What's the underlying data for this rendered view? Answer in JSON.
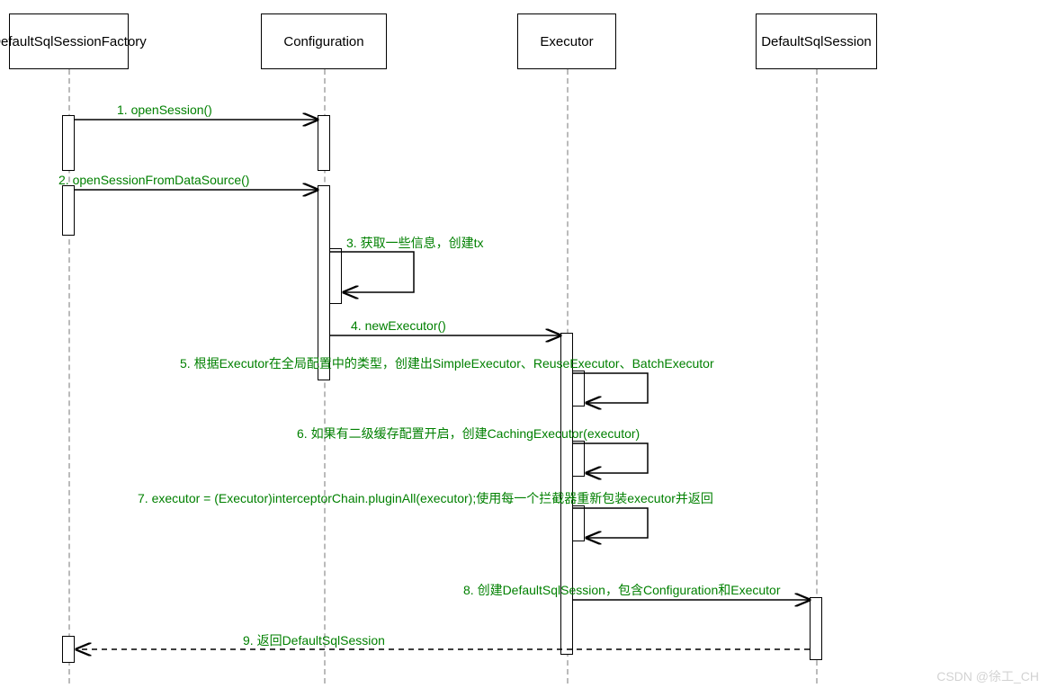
{
  "participants": {
    "p1": "DefaultSqlSessionFactory",
    "p2": "Configuration",
    "p3": "Executor",
    "p4": "DefaultSqlSession"
  },
  "messages": {
    "m1": "1. openSession()",
    "m2": "2. openSessionFromDataSource()",
    "m3": "3. 获取一些信息，创建tx",
    "m4": "4. newExecutor()",
    "m5": "5. 根据Executor在全局配置中的类型，创建出SimpleExecutor、ReuseExecutor、BatchExecutor",
    "m6": "6. 如果有二级缓存配置开启，创建CachingExecutor(executor)",
    "m7": "7. executor = (Executor)interceptorChain.pluginAll(executor);使用每一个拦截器重新包装executor并返回",
    "m8": "8. 创建DefaultSqlSession，包含Configuration和Executor",
    "m9": "9. 返回DefaultSqlSession"
  },
  "watermark": "CSDN @徐工_CH",
  "chart_data": {
    "type": "sequence-diagram",
    "participants": [
      "DefaultSqlSessionFactory",
      "Configuration",
      "Executor",
      "DefaultSqlSession"
    ],
    "interactions": [
      {
        "n": 1,
        "from": "DefaultSqlSessionFactory",
        "to": "Configuration",
        "kind": "call",
        "label": "openSession()"
      },
      {
        "n": 2,
        "from": "DefaultSqlSessionFactory",
        "to": "Configuration",
        "kind": "call",
        "label": "openSessionFromDataSource()"
      },
      {
        "n": 3,
        "from": "Configuration",
        "to": "Configuration",
        "kind": "self",
        "label": "获取一些信息，创建tx"
      },
      {
        "n": 4,
        "from": "Configuration",
        "to": "Executor",
        "kind": "call",
        "label": "newExecutor()"
      },
      {
        "n": 5,
        "from": "Executor",
        "to": "Executor",
        "kind": "self",
        "label": "根据Executor在全局配置中的类型，创建出SimpleExecutor、ReuseExecutor、BatchExecutor"
      },
      {
        "n": 6,
        "from": "Executor",
        "to": "Executor",
        "kind": "self",
        "label": "如果有二级缓存配置开启，创建CachingExecutor(executor)"
      },
      {
        "n": 7,
        "from": "Executor",
        "to": "Executor",
        "kind": "self",
        "label": "executor = (Executor)interceptorChain.pluginAll(executor);使用每一个拦截器重新包装executor并返回"
      },
      {
        "n": 8,
        "from": "Executor",
        "to": "DefaultSqlSession",
        "kind": "call",
        "label": "创建DefaultSqlSession，包含Configuration和Executor"
      },
      {
        "n": 9,
        "from": "DefaultSqlSession",
        "to": "DefaultSqlSessionFactory",
        "kind": "return",
        "label": "返回DefaultSqlSession"
      }
    ]
  }
}
